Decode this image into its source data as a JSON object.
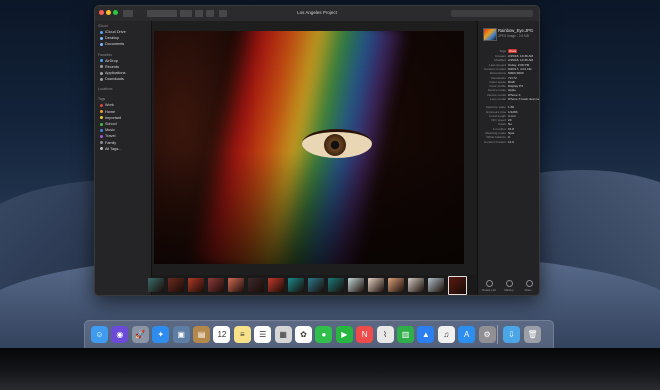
{
  "window": {
    "title": "Los Angeles Project"
  },
  "sidebar": {
    "sections": [
      {
        "heading": "iCloud",
        "items": [
          {
            "label": "iCloud Drive",
            "icon": "cloud-icon",
            "color": "#5aa0ff"
          },
          {
            "label": "Desktop",
            "icon": "folder-icon",
            "color": "#7fb8ff"
          },
          {
            "label": "Documents",
            "icon": "folder-icon",
            "color": "#7fb8ff"
          }
        ]
      },
      {
        "heading": "Favorites",
        "items": [
          {
            "label": "AirDrop",
            "icon": "airdrop-icon",
            "color": "#47a5ff"
          },
          {
            "label": "Recents",
            "icon": "clock-icon",
            "color": "#9aa0a8"
          },
          {
            "label": "Applications",
            "icon": "apps-icon",
            "color": "#9aa0a8"
          },
          {
            "label": "Downloads",
            "icon": "download-icon",
            "color": "#9aa0a8"
          }
        ]
      },
      {
        "heading": "Locations",
        "items": []
      },
      {
        "heading": "Tags",
        "items": [
          {
            "label": "Work",
            "color": "#e0463b"
          },
          {
            "label": "Home",
            "color": "#f0a01f"
          },
          {
            "label": "Important",
            "color": "#e6d02a"
          },
          {
            "label": "School",
            "color": "#3fbf4a"
          },
          {
            "label": "Music",
            "color": "#3f86e6"
          },
          {
            "label": "Travel",
            "color": "#a35bd6"
          },
          {
            "label": "Family",
            "color": "#8e8e92"
          },
          {
            "label": "All Tags...",
            "color": "#bdbdc0"
          }
        ]
      }
    ]
  },
  "inspector": {
    "file_name": "Rainbow_Eye.JPG",
    "file_info": "JPEG image - 2.6 MB",
    "tag_label": "Tags",
    "tag_value": "Work",
    "rows": [
      {
        "k": "Created",
        "v": "2/15/18, 10:36 AM"
      },
      {
        "k": "Modified",
        "v": "2/15/18, 10:36 AM"
      },
      {
        "k": "Last opened",
        "v": "Today, 2:08 PM"
      },
      {
        "k": "Content created",
        "v": "8/20/17, 4:01 AM"
      },
      {
        "k": "Dimensions",
        "v": "6000×4000"
      },
      {
        "k": "Resolution",
        "v": "72×72"
      },
      {
        "k": "Color space",
        "v": "RGB"
      },
      {
        "k": "Color profile",
        "v": "Display P3"
      },
      {
        "k": "Device make",
        "v": "Apple"
      },
      {
        "k": "Device model",
        "v": "iPhone X"
      },
      {
        "k": "Lens model",
        "v": "iPhone X back dual camera 6mm f/2.4"
      },
      {
        "k": "Aperture value",
        "v": "1.69"
      },
      {
        "k": "Exposure time",
        "v": "1/1283"
      },
      {
        "k": "Focal length",
        "v": "4 mm"
      },
      {
        "k": "ISO speed",
        "v": "20"
      },
      {
        "k": "Flash",
        "v": "No"
      },
      {
        "k": "F number",
        "v": "f/1.8"
      },
      {
        "k": "Metering mode",
        "v": "Spot"
      },
      {
        "k": "White balance",
        "v": "0"
      },
      {
        "k": "Content Creator",
        "v": "11.0"
      }
    ],
    "actions": [
      {
        "label": "Rotate Left",
        "icon": "rotate-left-icon"
      },
      {
        "label": "Markup",
        "icon": "markup-icon"
      },
      {
        "label": "More...",
        "icon": "more-icon"
      }
    ]
  },
  "filmstrip": {
    "thumb_colors": [
      "#3a6b6a",
      "#6b2a1f",
      "#b03a26",
      "#8e3a3a",
      "#d06a55",
      "#3a2a2a",
      "#c0392b",
      "#1a8a8a",
      "#2a7a8a",
      "#1a7a7a",
      "#c2d6d6",
      "#e0cfc0",
      "#d9a07a",
      "#d0c9c0",
      "#b0c0c8",
      "#5a1a10"
    ]
  },
  "dock": {
    "apps": [
      {
        "name": "Finder",
        "icon": "finder-icon",
        "color": "#3e9bf0",
        "glyph": "☺"
      },
      {
        "name": "Siri",
        "icon": "siri-icon",
        "color": "#6b4ad8",
        "glyph": "◉"
      },
      {
        "name": "Launchpad",
        "icon": "launchpad-icon",
        "color": "#8c95a6",
        "glyph": "🚀"
      },
      {
        "name": "Safari",
        "icon": "safari-icon",
        "color": "#2f8cef",
        "glyph": "✦"
      },
      {
        "name": "Photo Browser",
        "icon": "photo-browser-icon",
        "color": "#5d7fa6",
        "glyph": "▣"
      },
      {
        "name": "Notebook",
        "icon": "notebook-icon",
        "color": "#b4874a",
        "glyph": "▤"
      },
      {
        "name": "Calendar",
        "icon": "calendar-icon",
        "color": "#ffffff",
        "glyph": "12"
      },
      {
        "name": "Notes",
        "icon": "notes-icon",
        "color": "#f7e28a",
        "glyph": "≡"
      },
      {
        "name": "Reminders",
        "icon": "reminders-icon",
        "color": "#ffffff",
        "glyph": "☰"
      },
      {
        "name": "Photo Frame",
        "icon": "photo-frame-icon",
        "color": "#d6d6d6",
        "glyph": "▦"
      },
      {
        "name": "Photos",
        "icon": "photos-icon",
        "color": "#ffffff",
        "glyph": "✿"
      },
      {
        "name": "Messages",
        "icon": "messages-icon",
        "color": "#2fbf4a",
        "glyph": "●"
      },
      {
        "name": "FaceTime",
        "icon": "facetime-icon",
        "color": "#27b63f",
        "glyph": "▶"
      },
      {
        "name": "News",
        "icon": "news-icon",
        "color": "#ef4b4b",
        "glyph": "N"
      },
      {
        "name": "Stocks",
        "icon": "stocks-icon",
        "color": "#e8e8e8",
        "glyph": "⌇"
      },
      {
        "name": "Numbers",
        "icon": "numbers-icon",
        "color": "#2fae4a",
        "glyph": "▥"
      },
      {
        "name": "Keynote",
        "icon": "keynote-icon",
        "color": "#2c7ff0",
        "glyph": "▲"
      },
      {
        "name": "iTunes",
        "icon": "itunes-icon",
        "color": "#f0f0f0",
        "glyph": "♫"
      },
      {
        "name": "App Store",
        "icon": "app-store-icon",
        "color": "#2c8ff0",
        "glyph": "A"
      },
      {
        "name": "System Preferences",
        "icon": "gear-icon",
        "color": "#8f8f94",
        "glyph": "⚙"
      },
      {
        "name": "Downloads",
        "icon": "downloads-folder-icon",
        "color": "#4aa6e6",
        "glyph": "⇩"
      },
      {
        "name": "Trash",
        "icon": "trash-icon",
        "color": "#9a9fa8",
        "glyph": "🗑"
      }
    ]
  }
}
